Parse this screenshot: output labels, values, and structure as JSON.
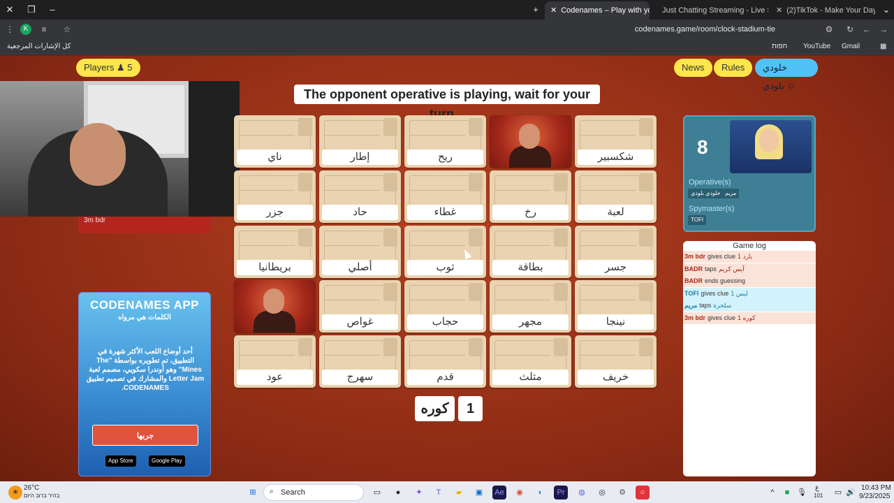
{
  "browser": {
    "tabs": [
      {
        "title": "Codenames – Play with your Fr",
        "active": true,
        "favicon_color": "#c0361b"
      },
      {
        "title": "Just Chatting Streaming - Live S",
        "active": false,
        "favicon_color": "#53fc18"
      },
      {
        "title": "(2)TikTok - Make Your Day",
        "active": false,
        "favicon_color": "#000000"
      }
    ],
    "url": "codenames.game/room/clock-stadium-tie",
    "profile_initial": "K",
    "bookmarks_all": "كل الإشارات المرجعية",
    "bookmarks": [
      "Gmail",
      "YouTube",
      "חפות"
    ]
  },
  "header": {
    "players_label": "Players",
    "players_count": "5",
    "news": "News",
    "rules": "Rules",
    "user_name": "خلودي بلودي",
    "status": "The opponent operative is playing, wait for your turn..."
  },
  "left": {
    "red_player": "3m bdr"
  },
  "ad": {
    "title": "CODENAMES APP",
    "subtitle": "الكلمات هي مرواه",
    "body": "أحد أوضاع اللعب الأكثر شهرة في التطبيق، تم تطويره بواسطة \"The Mines\" وهو أوندرا سكويي، مصمم لعبة Letter Jam والمشارك في تصميم تطبيق CODENAMES.",
    "button": "جربها",
    "app_store": "App Store",
    "google_play": "Google Play"
  },
  "board": [
    {
      "word": "ناي",
      "revealed": false
    },
    {
      "word": "إطار",
      "revealed": false
    },
    {
      "word": "ريح",
      "revealed": false
    },
    {
      "word": "",
      "revealed": true
    },
    {
      "word": "شكسبير",
      "revealed": false
    },
    {
      "word": "جزر",
      "revealed": false
    },
    {
      "word": "حاد",
      "revealed": false
    },
    {
      "word": "غطاء",
      "revealed": false
    },
    {
      "word": "رخ",
      "revealed": false
    },
    {
      "word": "لعبة",
      "revealed": false
    },
    {
      "word": "بريطانيا",
      "revealed": false
    },
    {
      "word": "أصلي",
      "revealed": false
    },
    {
      "word": "ثوب",
      "revealed": false
    },
    {
      "word": "بطاقة",
      "revealed": false
    },
    {
      "word": "جسر",
      "revealed": false
    },
    {
      "word": "",
      "revealed": true
    },
    {
      "word": "غواص",
      "revealed": false
    },
    {
      "word": "حجاب",
      "revealed": false
    },
    {
      "word": "مجهر",
      "revealed": false
    },
    {
      "word": "نينجا",
      "revealed": false
    },
    {
      "word": "عود",
      "revealed": false
    },
    {
      "word": "سهرج",
      "revealed": false
    },
    {
      "word": "قدم",
      "revealed": false
    },
    {
      "word": "مثلث",
      "revealed": false
    },
    {
      "word": "خريف",
      "revealed": false
    }
  ],
  "clue": {
    "word": "كوره",
    "number": "1"
  },
  "team": {
    "remaining": "8",
    "operatives_label": "Operative(s)",
    "operatives": [
      "خلودي بلودي",
      "مريم"
    ],
    "spymaster_label": "Spymaster(s)",
    "spymasters": [
      "TOFI"
    ]
  },
  "gamelog": {
    "title": "Game log",
    "entries": [
      {
        "who": "3m bdr",
        "team": "red",
        "text": "gives clue",
        "detail": "بارد 1"
      },
      {
        "who": "BADR",
        "team": "red",
        "text": "taps",
        "detail": "آيس كريم"
      },
      {
        "who": "BADR",
        "team": "red",
        "text": "ends guessing",
        "detail": ""
      },
      {
        "who": "TOFI",
        "team": "blue",
        "text": "gives clue",
        "detail": "ليس 1"
      },
      {
        "who": "مريم",
        "team": "blue",
        "text": "taps",
        "detail": "سلحرة"
      },
      {
        "who": "3m bdr",
        "team": "red",
        "text": "gives clue",
        "detail": "كوره 1"
      }
    ]
  },
  "taskbar": {
    "weather_temp": "26°C",
    "weather_desc": "בהיר ברוב היום",
    "search": "Search",
    "time": "10:43 PM",
    "date": "9/23/2025",
    "lang": "ع",
    "lang_num": "101"
  }
}
